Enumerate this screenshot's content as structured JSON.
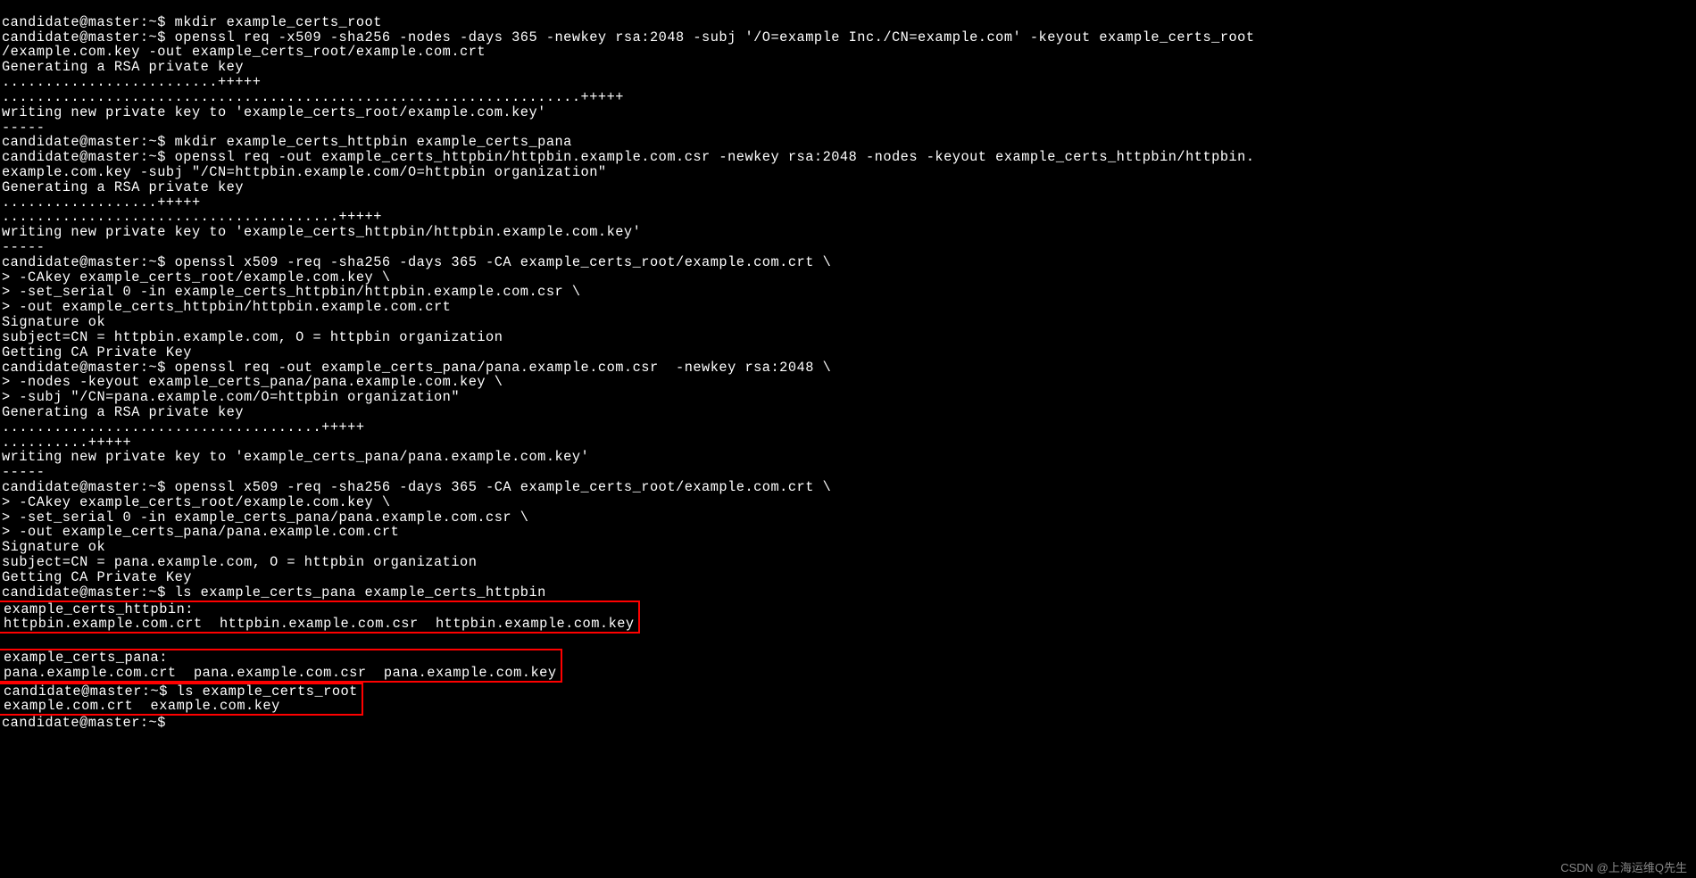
{
  "prompt": "candidate@master:~$",
  "continuation_prompt": ">",
  "lines": {
    "l1": "candidate@master:~$ mkdir example_certs_root",
    "l2": "candidate@master:~$ openssl req -x509 -sha256 -nodes -days 365 -newkey rsa:2048 -subj '/O=example Inc./CN=example.com' -keyout example_certs_root",
    "l3": "/example.com.key -out example_certs_root/example.com.crt",
    "l4": "Generating a RSA private key",
    "l5": ".........................+++++",
    "l6": "...................................................................+++++",
    "l7": "writing new private key to 'example_certs_root/example.com.key'",
    "l8": "-----",
    "l9": "candidate@master:~$ mkdir example_certs_httpbin example_certs_pana",
    "l10": "candidate@master:~$ openssl req -out example_certs_httpbin/httpbin.example.com.csr -newkey rsa:2048 -nodes -keyout example_certs_httpbin/httpbin.",
    "l11": "example.com.key -subj \"/CN=httpbin.example.com/O=httpbin organization\"",
    "l12": "Generating a RSA private key",
    "l13": "..................+++++",
    "l14": ".......................................+++++",
    "l15": "writing new private key to 'example_certs_httpbin/httpbin.example.com.key'",
    "l16": "-----",
    "l17": "candidate@master:~$ openssl x509 -req -sha256 -days 365 -CA example_certs_root/example.com.crt \\",
    "l18": "> -CAkey example_certs_root/example.com.key \\",
    "l19": "> -set_serial 0 -in example_certs_httpbin/httpbin.example.com.csr \\",
    "l20": "> -out example_certs_httpbin/httpbin.example.com.crt",
    "l21": "Signature ok",
    "l22": "subject=CN = httpbin.example.com, O = httpbin organization",
    "l23": "Getting CA Private Key",
    "l24": "candidate@master:~$ openssl req -out example_certs_pana/pana.example.com.csr  -newkey rsa:2048 \\",
    "l25": "> -nodes -keyout example_certs_pana/pana.example.com.key \\",
    "l26": "> -subj \"/CN=pana.example.com/O=httpbin organization\"",
    "l27": "Generating a RSA private key",
    "l28": ".....................................+++++",
    "l29": "..........+++++",
    "l30": "writing new private key to 'example_certs_pana/pana.example.com.key'",
    "l31": "-----",
    "l32": "candidate@master:~$ openssl x509 -req -sha256 -days 365 -CA example_certs_root/example.com.crt \\",
    "l33": "> -CAkey example_certs_root/example.com.key \\",
    "l34": "> -set_serial 0 -in example_certs_pana/pana.example.com.csr \\",
    "l35": "> -out example_certs_pana/pana.example.com.crt",
    "l36": "Signature ok",
    "l37": "subject=CN = pana.example.com, O = httpbin organization",
    "l38": "Getting CA Private Key",
    "l39": "candidate@master:~$ ls example_certs_pana example_certs_httpbin",
    "l40": "example_certs_httpbin:",
    "l41": "httpbin.example.com.crt  httpbin.example.com.csr  httpbin.example.com.key",
    "l42": "",
    "l43": "example_certs_pana:",
    "l44": "pana.example.com.crt  pana.example.com.csr  pana.example.com.key",
    "l45": "candidate@master:~$ ls example_certs_root",
    "l46": "example.com.crt  example.com.key",
    "l47": "candidate@master:~$"
  },
  "watermark": "CSDN @上海运维Q先生"
}
